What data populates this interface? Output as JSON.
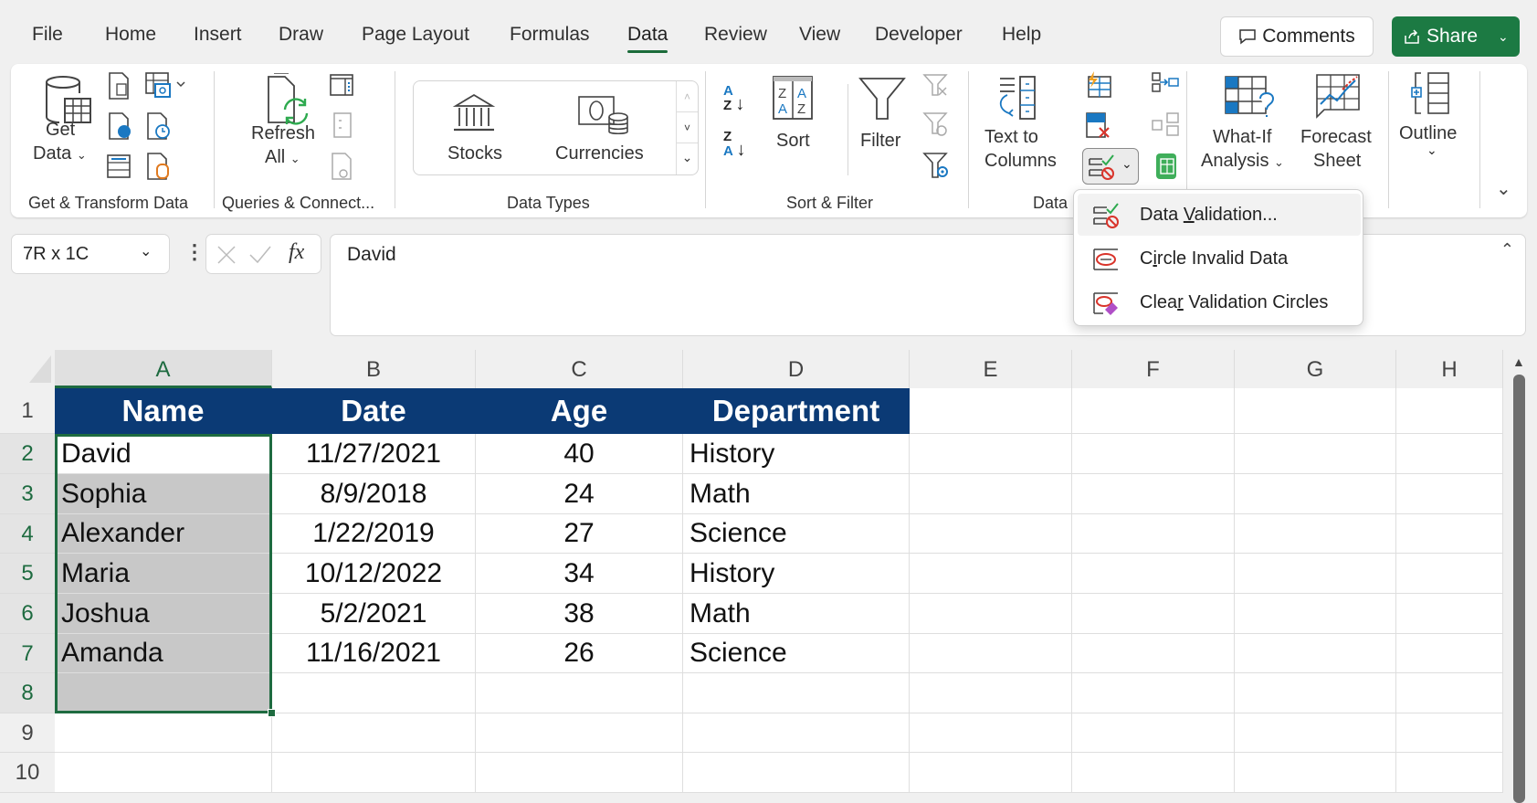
{
  "menu_tabs": [
    {
      "label": "File"
    },
    {
      "label": "Home"
    },
    {
      "label": "Insert"
    },
    {
      "label": "Draw"
    },
    {
      "label": "Page Layout"
    },
    {
      "label": "Formulas"
    },
    {
      "label": "Data",
      "active": true
    },
    {
      "label": "Review"
    },
    {
      "label": "View"
    },
    {
      "label": "Developer"
    },
    {
      "label": "Help"
    }
  ],
  "header_buttons": {
    "comments": "Comments",
    "share": "Share"
  },
  "ribbon": {
    "get_transform": {
      "group_label": "Get & Transform Data",
      "get_data_line1": "Get",
      "get_data_line2": "Data"
    },
    "queries": {
      "group_label": "Queries & Connect...",
      "refresh_line1": "Refresh",
      "refresh_line2": "All"
    },
    "data_types": {
      "group_label": "Data Types",
      "stocks": "Stocks",
      "currencies": "Currencies"
    },
    "sort_filter": {
      "group_label": "Sort & Filter",
      "sort": "Sort",
      "filter": "Filter"
    },
    "data_tools": {
      "group_label": "Data Tools",
      "group_label_visible": "Data",
      "text_to_columns_line1": "Text to",
      "text_to_columns_line2": "Columns"
    },
    "forecast": {
      "what_if_line1": "What-If",
      "what_if_line2": "Analysis",
      "forecast_line1": "Forecast",
      "forecast_line2": "Sheet"
    },
    "outline": {
      "label": "Outline"
    }
  },
  "dropdown_menu": {
    "items": [
      {
        "pre": "Data ",
        "accel": "V",
        "post": "alidation..."
      },
      {
        "pre": "C",
        "accel": "i",
        "post": "rcle Invalid Data"
      },
      {
        "pre": "Clea",
        "accel": "r",
        "post": " Validation Circles"
      }
    ]
  },
  "formula_bar": {
    "name_box": "7R x 1C",
    "fx_label": "fx",
    "content": "David"
  },
  "sheet": {
    "columns": [
      "A",
      "B",
      "C",
      "D",
      "E",
      "F",
      "G",
      "H"
    ],
    "rows": [
      "1",
      "2",
      "3",
      "4",
      "5",
      "6",
      "7",
      "8",
      "9",
      "10"
    ],
    "header": [
      "Name",
      "Date",
      "Age",
      "Department"
    ],
    "data": [
      [
        "David",
        "11/27/2021",
        "40",
        "History"
      ],
      [
        "Sophia",
        "8/9/2018",
        "24",
        "Math"
      ],
      [
        "Alexander",
        "1/22/2019",
        "27",
        "Science"
      ],
      [
        "Maria",
        "10/12/2022",
        "34",
        "History"
      ],
      [
        "Joshua",
        "5/2/2021",
        "38",
        "Math"
      ],
      [
        "Amanda",
        "11/16/2021",
        "26",
        "Science"
      ]
    ],
    "selection": "A2:A8",
    "header_fill": "#0b3a75",
    "selection_color": "#1e6b40"
  }
}
